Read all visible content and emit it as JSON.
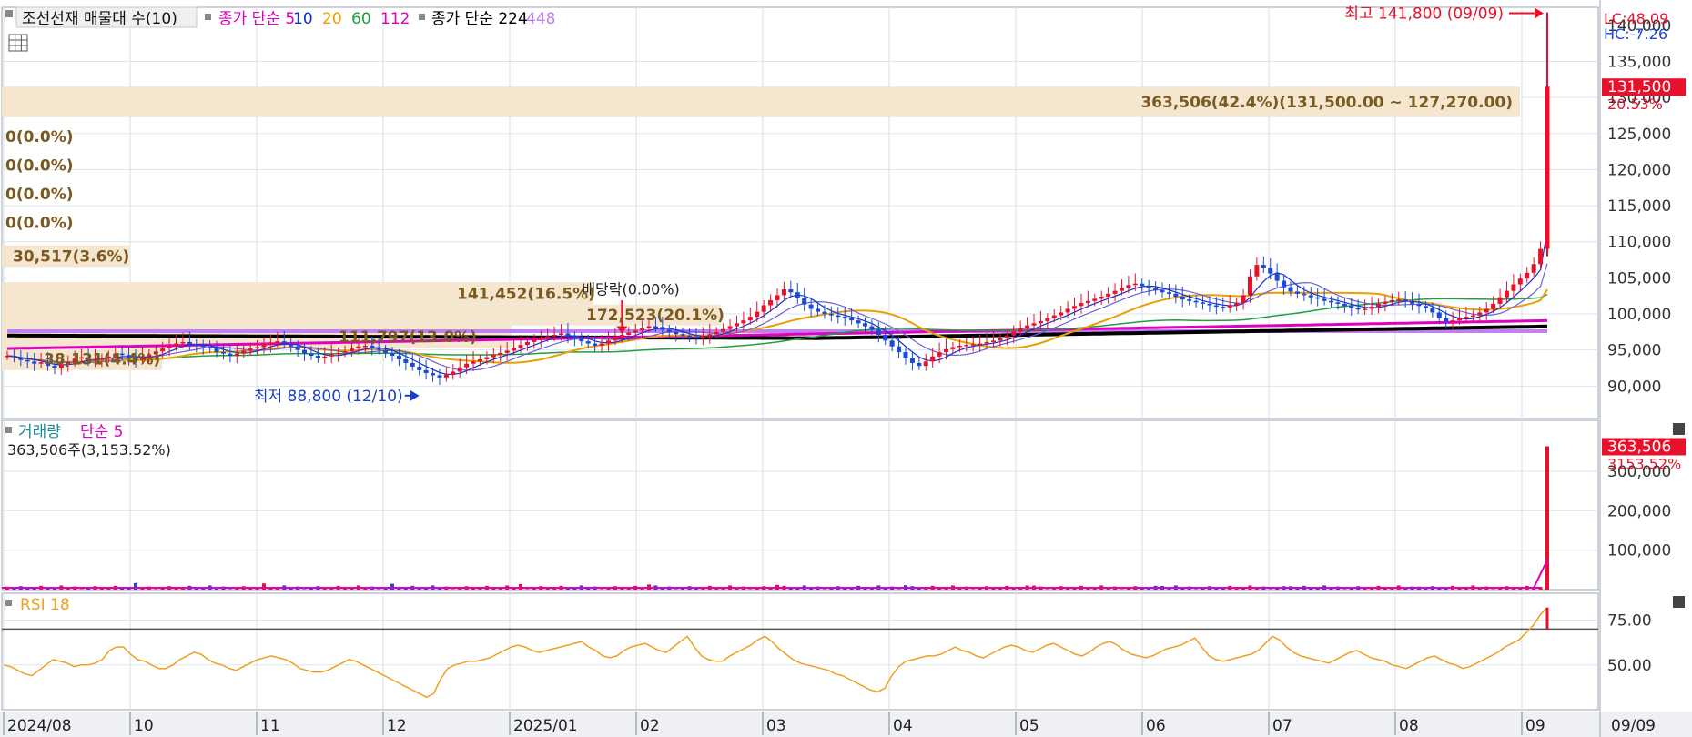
{
  "main_panel": {
    "title": "조선선재 매물대 수(10)",
    "ma_legend": [
      {
        "text": "종가 단순 5",
        "color": "#e000c0"
      },
      {
        "text": "10",
        "color": "#1030d0"
      },
      {
        "text": "20",
        "color": "#e8a000"
      },
      {
        "text": "60",
        "color": "#20a040"
      },
      {
        "text": "112",
        "color": "#e000c0"
      }
    ],
    "ma_legend2": [
      {
        "text": "종가 단순 224",
        "color": "#000000"
      },
      {
        "text": "448",
        "color": "#c080f0"
      }
    ],
    "lc_label": "LC:48.09",
    "hc_label": "HC:-7.26",
    "current_price": "131,500",
    "current_change": "20.53%",
    "high_label": "최고 141,800 (09/09)",
    "low_label": "최저 88,800 (12/10)",
    "dividend_label": "배당락(0.00%)",
    "big_volume_label": "363,506(42.4%)(131,500.00 ~ 127,270.00)",
    "zero_labels": [
      "0(0.0%)",
      "0(0.0%)",
      "0(0.0%)",
      "0(0.0%)"
    ],
    "vp_labels": [
      "30,517(3.6%)",
      "141,452(16.5%)",
      "172,523(20.1%)",
      "111,797(13.0%)",
      "38,131(4.4%)"
    ]
  },
  "volume_panel": {
    "title": "거래량",
    "ma_label": "단순 5",
    "info": "363,506주(3,153.52%)",
    "current_value": "363,506",
    "current_pct": "3153.52%"
  },
  "rsi_panel": {
    "title": "RSI 18"
  },
  "colors": {
    "up": "#e8102a",
    "down": "#1a48d8",
    "rsi": "#f0a020",
    "ma5": "#1030d0",
    "ma20": "#e8a000",
    "ma60": "#20a040",
    "ma112": "#e000c0",
    "ma224": "#000000",
    "ma448": "#c080f0",
    "vp_band": "#f5e6d0",
    "vp_text": "#7a5a20"
  },
  "chart_data": [
    {
      "type": "candlestick",
      "title": "조선선재 매물대 수(10)",
      "x_labels": [
        "2024/08",
        "10",
        "11",
        "12",
        "2025/01",
        "02",
        "03",
        "04",
        "05",
        "06",
        "07",
        "08",
        "09"
      ],
      "y_ticks": [
        90000,
        95000,
        100000,
        105000,
        110000,
        115000,
        120000,
        125000,
        130000,
        135000,
        140000
      ],
      "ylim": [
        85500,
        142500
      ],
      "series_close": [
        94200,
        94000,
        93600,
        93400,
        93100,
        93300,
        92800,
        92500,
        93000,
        93300,
        93800,
        94000,
        93600,
        93700,
        93800,
        94100,
        94500,
        94300,
        93800,
        93600,
        94000,
        94400,
        94800,
        95200,
        95500,
        95900,
        96100,
        95800,
        95600,
        95400,
        95200,
        94700,
        94500,
        94200,
        94500,
        94900,
        95200,
        95400,
        95700,
        96000,
        96200,
        95900,
        95500,
        95000,
        94500,
        94200,
        93900,
        94100,
        94400,
        94600,
        94800,
        95200,
        95500,
        95600,
        95300,
        95000,
        94600,
        94200,
        93700,
        93200,
        92700,
        92200,
        91800,
        91500,
        91200,
        91600,
        92000,
        92600,
        93100,
        93400,
        93700,
        94000,
        94300,
        94600,
        94900,
        95300,
        95700,
        96100,
        96400,
        96700,
        96900,
        97100,
        97300,
        96900,
        96600,
        96200,
        95900,
        95600,
        95900,
        96300,
        96700,
        97100,
        97400,
        97700,
        98000,
        98300,
        98200,
        97800,
        97500,
        97200,
        97000,
        96800,
        96600,
        96900,
        97200,
        97500,
        97900,
        98300,
        98700,
        99100,
        99600,
        100300,
        101200,
        101900,
        102600,
        103400,
        103000,
        102200,
        101300,
        100700,
        100300,
        100000,
        99800,
        99600,
        99400,
        99100,
        98700,
        98300,
        97800,
        97100,
        96300,
        95500,
        94700,
        93900,
        93200,
        92800,
        93400,
        94100,
        94700,
        95100,
        95400,
        95600,
        95700,
        95800,
        95900,
        96100,
        96300,
        96600,
        97000,
        97500,
        98000,
        98400,
        98700,
        99000,
        99400,
        99800,
        100200,
        100700,
        101100,
        101500,
        101800,
        102100,
        102400,
        102800,
        103200,
        103600,
        104000,
        104200,
        103900,
        103600,
        103300,
        103000,
        102800,
        102400,
        102000,
        101800,
        101600,
        101400,
        101200,
        101000,
        100900,
        101200,
        101500,
        102600,
        105200,
        106800,
        106400,
        105600,
        104600,
        103700,
        103100,
        102800,
        102600,
        102300,
        102100,
        101800,
        101600,
        101400,
        101100,
        100800,
        100600,
        100700,
        101000,
        101400,
        101700,
        101900,
        102000,
        101700,
        101400,
        101100,
        100800,
        100200,
        99400,
        98900,
        99100,
        99400,
        99600,
        99800,
        100200,
        100700,
        101400,
        102300,
        103200,
        104100,
        104900,
        105700,
        106900,
        109000,
        131500
      ],
      "rsi_series": [
        50,
        49,
        47,
        45,
        44,
        47,
        50,
        53,
        52,
        51,
        49,
        50,
        50,
        51,
        53,
        58,
        60,
        60,
        56,
        53,
        52,
        50,
        48,
        48,
        50,
        53,
        55,
        57,
        56,
        53,
        51,
        50,
        48,
        47,
        49,
        51,
        53,
        54,
        55,
        54,
        53,
        51,
        48,
        47,
        46,
        46,
        47,
        49,
        51,
        53,
        52,
        50,
        48,
        46,
        44,
        42,
        40,
        38,
        36,
        34,
        32,
        34,
        42,
        48,
        50,
        51,
        52,
        52,
        53,
        54,
        56,
        58,
        60,
        61,
        60,
        58,
        57,
        58,
        59,
        60,
        61,
        62,
        63,
        60,
        58,
        55,
        54,
        55,
        58,
        60,
        61,
        62,
        60,
        58,
        57,
        60,
        63,
        66,
        60,
        55,
        53,
        52,
        52,
        55,
        57,
        59,
        61,
        64,
        66,
        63,
        59,
        56,
        53,
        51,
        50,
        49,
        48,
        47,
        45,
        44,
        42,
        40,
        38,
        36,
        35,
        37,
        44,
        49,
        52,
        53,
        54,
        55,
        55,
        56,
        58,
        60,
        58,
        57,
        55,
        54,
        56,
        58,
        60,
        61,
        60,
        58,
        57,
        59,
        61,
        62,
        60,
        58,
        56,
        55,
        57,
        60,
        62,
        63,
        61,
        58,
        56,
        55,
        54,
        55,
        57,
        59,
        60,
        61,
        63,
        65,
        60,
        55,
        53,
        52,
        53,
        54,
        55,
        56,
        58,
        62,
        66,
        64,
        60,
        57,
        55,
        54,
        53,
        52,
        51,
        53,
        55,
        57,
        58,
        56,
        54,
        53,
        52,
        50,
        49,
        48,
        50,
        52,
        54,
        55,
        53,
        51,
        50,
        48,
        49,
        51,
        53,
        55,
        57,
        60,
        62,
        64,
        68,
        72,
        78,
        82
      ],
      "volume_peak": 363506
    }
  ]
}
